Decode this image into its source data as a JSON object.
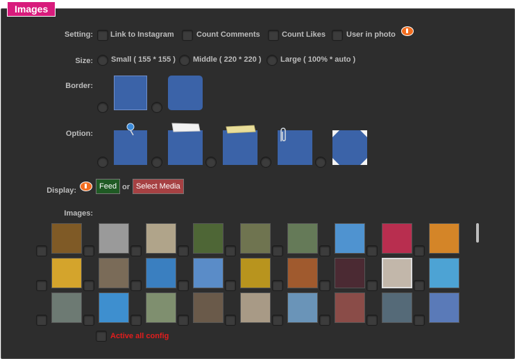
{
  "tab": "Images",
  "setting": {
    "label": "Setting:",
    "options": [
      "Link to Instagram",
      "Count Comments",
      "Count Likes",
      "User in photo"
    ]
  },
  "size": {
    "label": "Size:",
    "options": [
      "Small ( 155 * 155 )",
      "Middle ( 220 * 220 )",
      "Large ( 100% * auto )"
    ]
  },
  "border": {
    "label": "Border:"
  },
  "option": {
    "label": "Option:",
    "styles": [
      "pin-icon",
      "tape-icon",
      "note-icon",
      "clip-icon",
      "octagon-icon"
    ]
  },
  "display": {
    "label": "Display:",
    "feed": "Feed",
    "or": "or",
    "select_media": "Select Media",
    "colors": {
      "feed": "#1f5a24",
      "select_media": "#a64143"
    }
  },
  "images": {
    "label": "Images:",
    "thumbs": [
      "#7f5a26",
      "#9a9a9a",
      "#b0a48a",
      "#4e6636",
      "#6f7450",
      "#657a58",
      "#4f93d0",
      "#b82e4f",
      "#d48528",
      "#d4a42c",
      "#7a6b58",
      "#3a7fc0",
      "#5a8cc8",
      "#b8941e",
      "#a05a2e",
      "#4b2a33",
      "#c2b7aa",
      "#4da3d4",
      "#6d7a73",
      "#3e8fcf",
      "#7f8f6f",
      "#6a5a4a",
      "#a89a86",
      "#6a94b8",
      "#8a4c48",
      "#556a78",
      "#5a7ab8"
    ]
  },
  "footer": {
    "active_all": "Active all config"
  }
}
